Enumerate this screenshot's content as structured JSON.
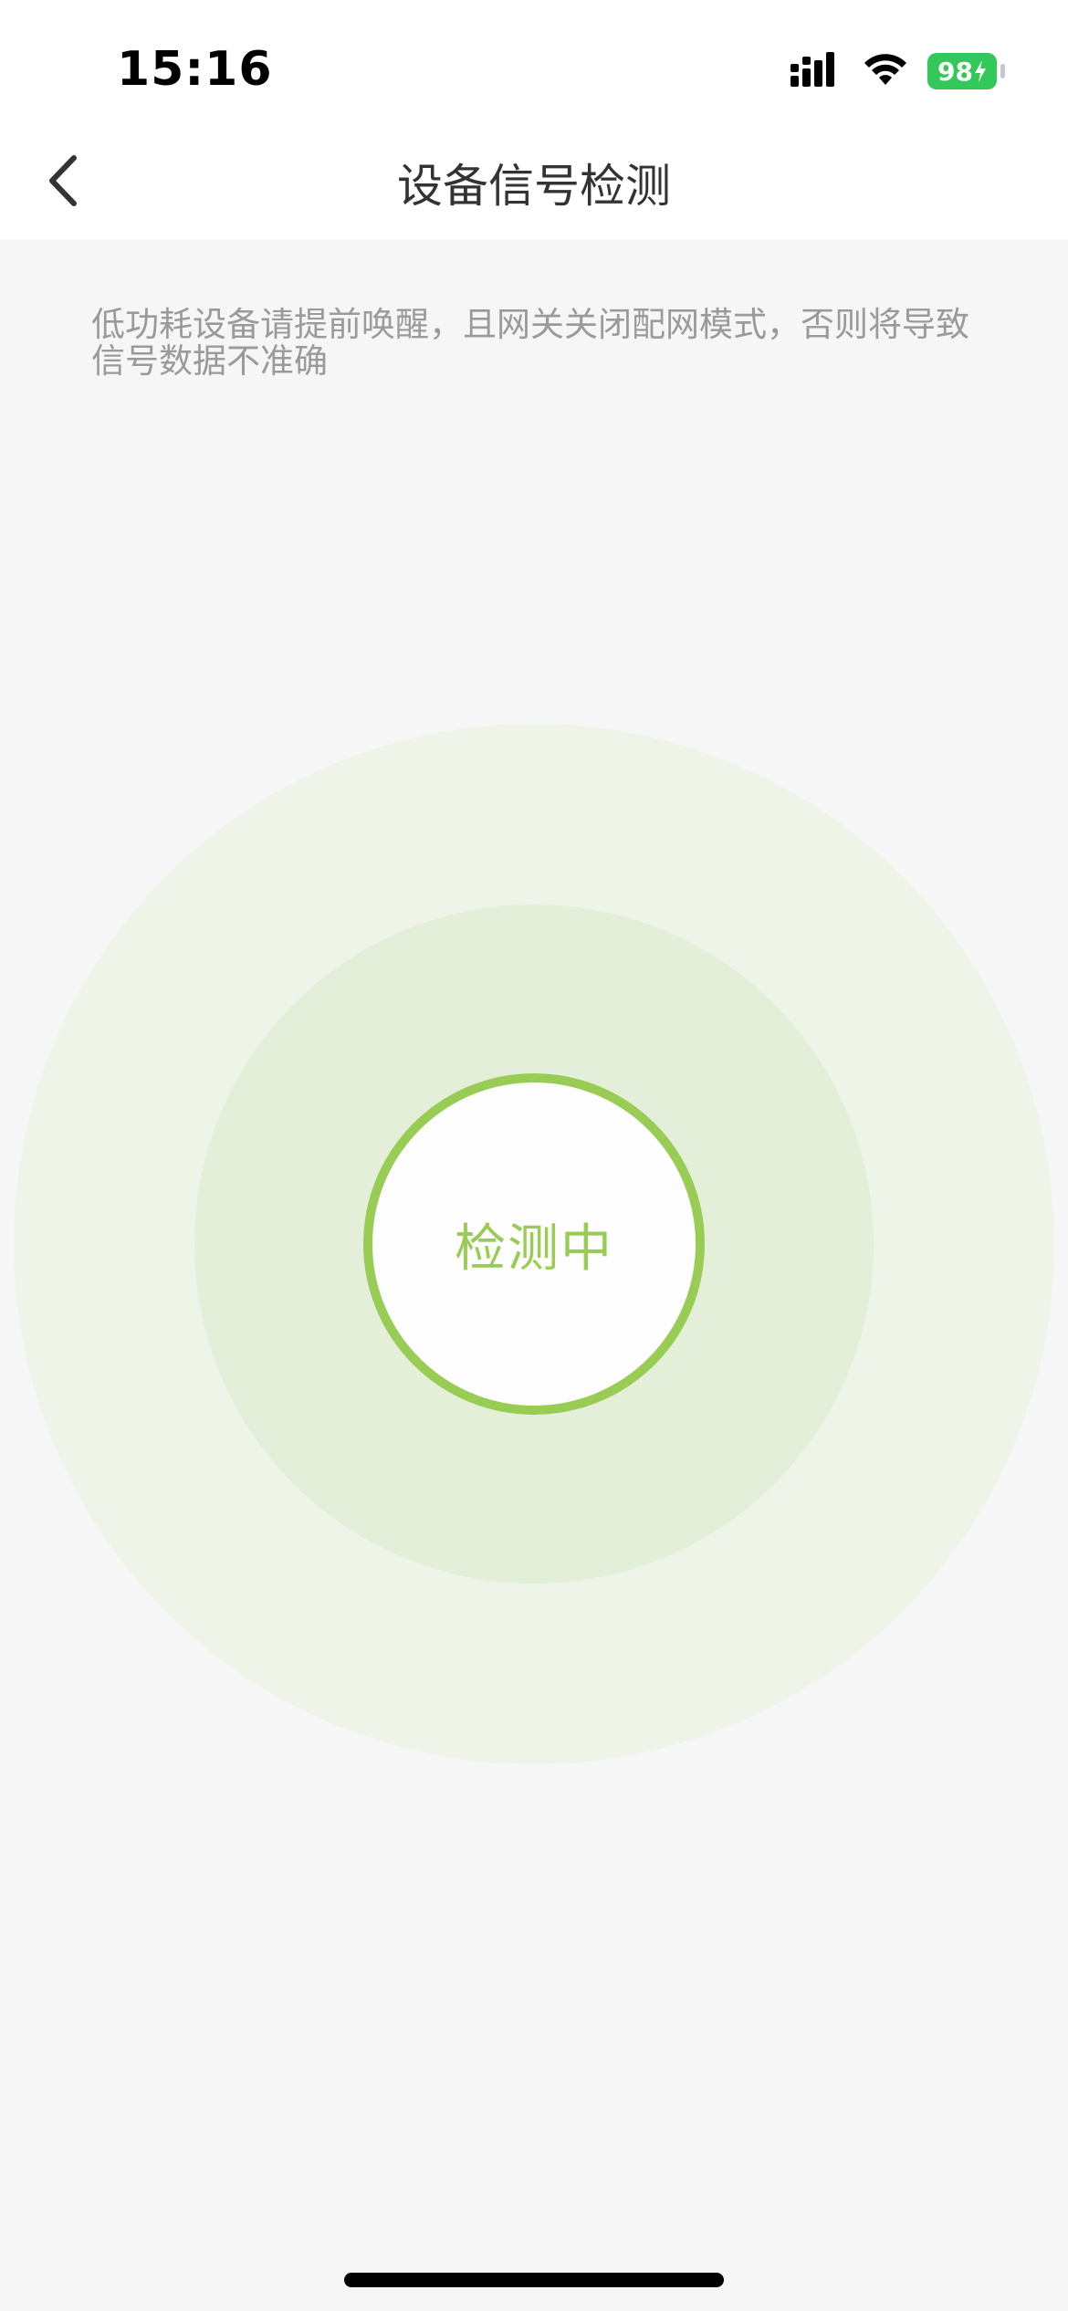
{
  "status_bar": {
    "time": "15:16",
    "battery_level": "98",
    "icons": [
      "cellular-signal-icon",
      "wifi-icon",
      "battery-charging-icon"
    ]
  },
  "nav": {
    "back_icon": "chevron-left-icon",
    "title": "设备信号检测"
  },
  "hint": {
    "text": "低功耗设备请提前唤醒，且网关关闭配网模式，否则将导致信号数据不准确"
  },
  "scanner": {
    "status_label": "检测中",
    "accent_color": "#99cc55",
    "ring_colors": [
      "#eef4e8",
      "#e4efd9"
    ]
  },
  "colors": {
    "background": "#f6f6f6",
    "header_bg": "#ffffff",
    "battery": "#34c759"
  }
}
